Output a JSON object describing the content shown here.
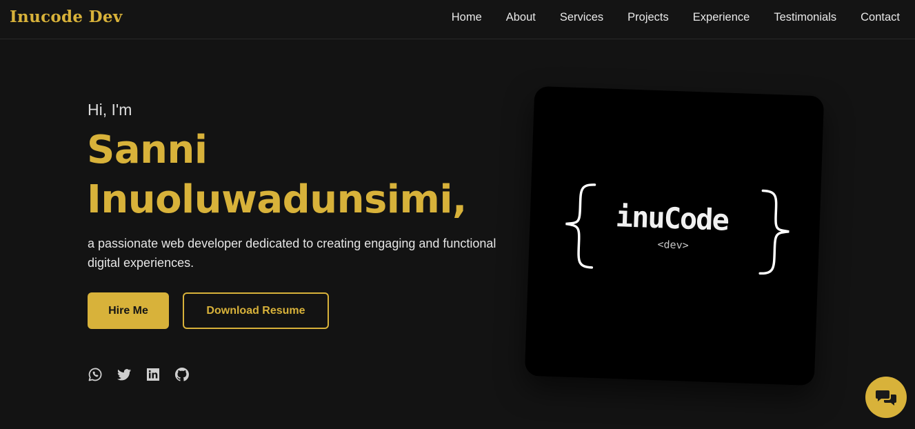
{
  "brand": "Inucode Dev",
  "nav": [
    "Home",
    "About",
    "Services",
    "Projects",
    "Experience",
    "Testimonials",
    "Contact"
  ],
  "hero": {
    "greeting": "Hi, I'm",
    "name_line1": "Sanni",
    "name_line2": "Inuoluwadunsimi,",
    "description": "a passionate web developer dedicated to creating engaging and functional digital experiences.",
    "hire_button": "Hire Me",
    "resume_button": "Download Resume"
  },
  "socials": [
    "whatsapp-icon",
    "twitter-icon",
    "linkedin-icon",
    "github-icon"
  ],
  "logo": {
    "text": "inuCode",
    "subtext": "<dev>"
  },
  "chat_icon": "chat-bubbles-icon",
  "colors": {
    "accent": "#d8b23a",
    "background": "#131313",
    "card": "#000000"
  }
}
